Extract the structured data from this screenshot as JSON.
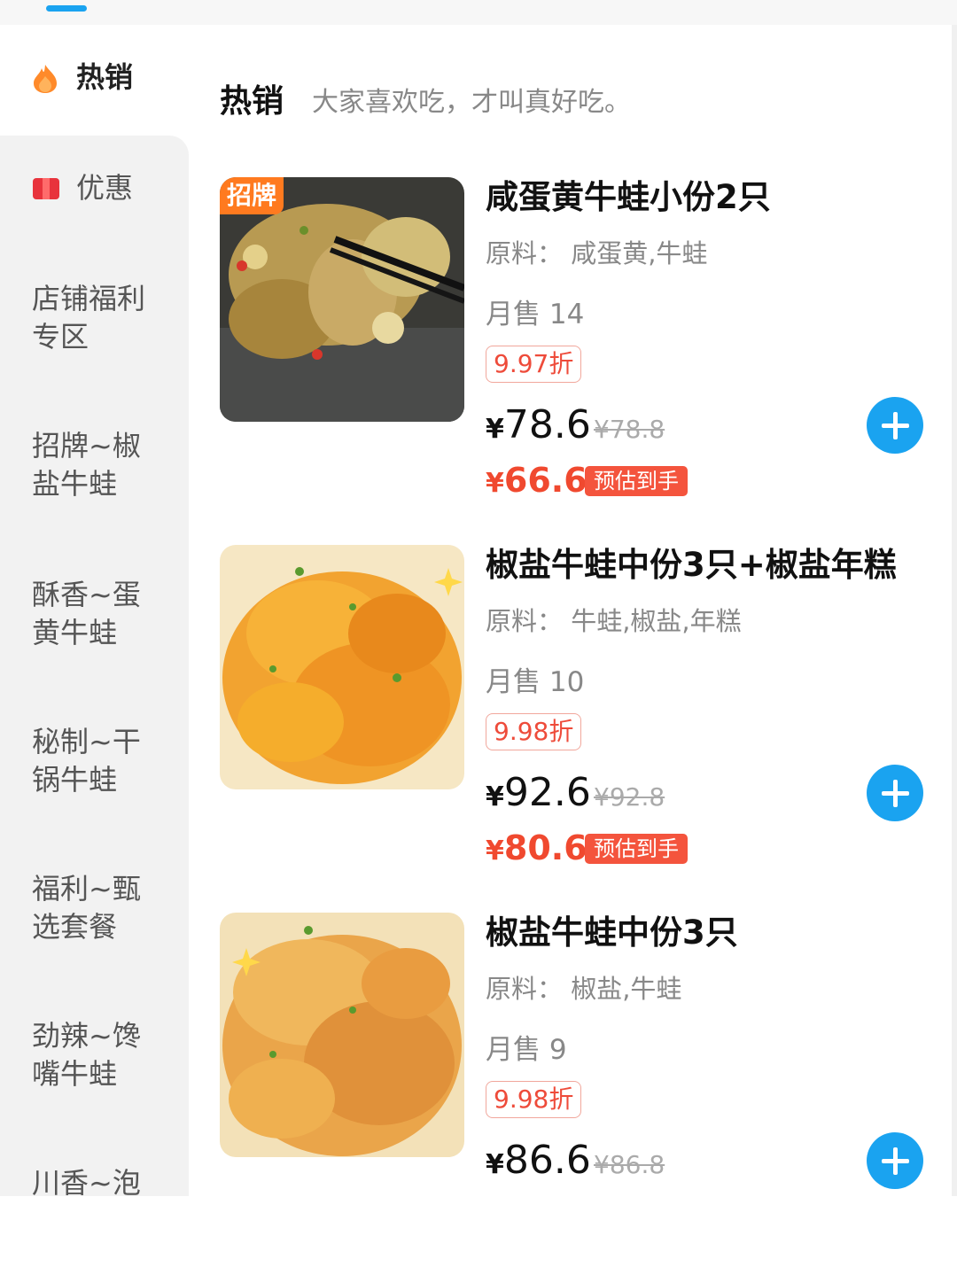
{
  "sidebar": {
    "items": [
      {
        "label": "热销",
        "icon": "fire-icon",
        "active": true
      },
      {
        "label": "优惠",
        "icon": "coupon-icon"
      },
      {
        "label": "店铺福利专区"
      },
      {
        "label": "招牌~椒盐牛蛙"
      },
      {
        "label": "酥香~蛋黄牛蛙"
      },
      {
        "label": "秘制~干锅牛蛙"
      },
      {
        "label": "福利~甄选套餐"
      },
      {
        "label": "劲辣~馋嘴牛蛙"
      },
      {
        "label": "川香~泡"
      }
    ]
  },
  "section": {
    "title": "热销",
    "subtitle": "大家喜欢吃，才叫真好吃。"
  },
  "products": [
    {
      "badge": "招牌",
      "name": "咸蛋黄牛蛙小份2只",
      "ingredients": "原料：  咸蛋黄,牛蛙",
      "sales": "月售 14",
      "discount": "9.97折",
      "currency": "¥",
      "price": "78.6",
      "original_price": "¥78.8",
      "final_price": "66.6",
      "final_tag": "预估到手"
    },
    {
      "name": "椒盐牛蛙中份3只+椒盐年糕",
      "ingredients": "原料：  牛蛙,椒盐,年糕",
      "sales": "月售 10",
      "discount": "9.98折",
      "currency": "¥",
      "price": "92.6",
      "original_price": "¥92.8",
      "final_price": "80.6",
      "final_tag": "预估到手"
    },
    {
      "name": "椒盐牛蛙中份3只",
      "ingredients": "原料：  椒盐,牛蛙",
      "sales": "月售 9",
      "discount": "9.98折",
      "currency": "¥",
      "price": "86.6",
      "original_price": "¥86.8"
    }
  ],
  "colors": {
    "accent_blue": "#1aa3f0",
    "price_red": "#f0492f",
    "badge_orange": "#ff7a1f"
  }
}
